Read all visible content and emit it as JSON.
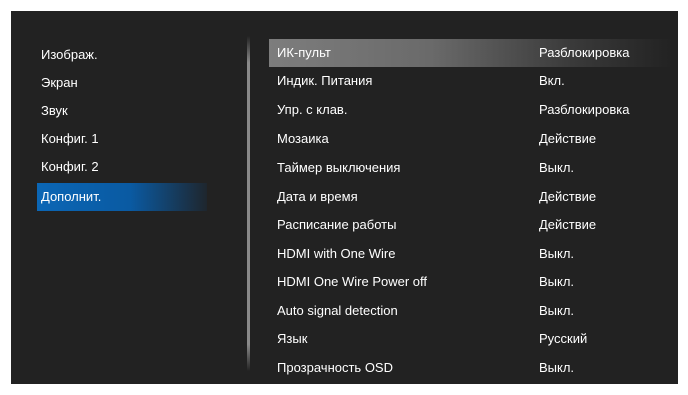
{
  "left_menu": {
    "items": [
      {
        "label": "Изображ."
      },
      {
        "label": "Экран"
      },
      {
        "label": "Звук"
      },
      {
        "label": "Конфиг. 1"
      },
      {
        "label": "Конфиг. 2"
      },
      {
        "label": "Дополнит."
      }
    ],
    "active_item": "Дополнит."
  },
  "settings": {
    "rows": [
      {
        "label": "ИК-пульт",
        "value": "Разблокировка"
      },
      {
        "label": "Индик. Питания",
        "value": "Вкл."
      },
      {
        "label": "Упр. с клав.",
        "value": "Разблокировка"
      },
      {
        "label": "Мозаика",
        "value": "Действие"
      },
      {
        "label": "Таймер выключения",
        "value": "Выкл."
      },
      {
        "label": "Дата и время",
        "value": "Действие"
      },
      {
        "label": "Расписание работы",
        "value": "Действие"
      },
      {
        "label": "HDMI with One Wire",
        "value": "Выкл."
      },
      {
        "label": "HDMI One Wire Power off",
        "value": "Выкл."
      },
      {
        "label": "Auto signal detection",
        "value": "Выкл."
      },
      {
        "label": "Язык",
        "value": "Русский"
      },
      {
        "label": "Прозрачность OSD",
        "value": "Выкл."
      }
    ],
    "selected_row": "ИК-пульт"
  },
  "colors": {
    "osd_background": "#222222",
    "active_menu_highlight": "#0b66b5",
    "selected_row_highlight": "#7d7d7d",
    "text": "#ffffff"
  }
}
